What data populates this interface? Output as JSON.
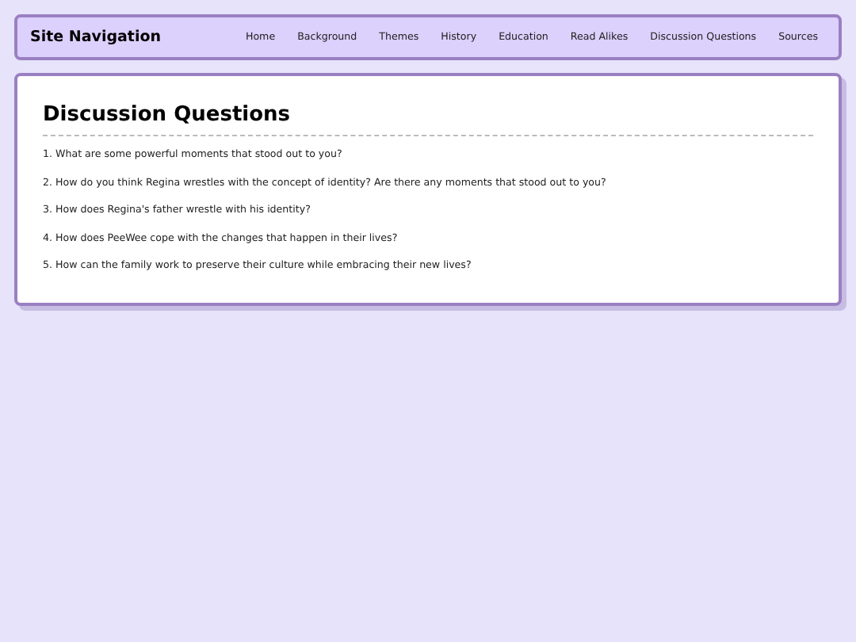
{
  "nav": {
    "title": "Site Navigation",
    "links": [
      "Home",
      "Background",
      "Themes",
      "History",
      "Education",
      "Read Alikes",
      "Discussion Questions",
      "Sources"
    ]
  },
  "main": {
    "heading": "Discussion Questions",
    "questions": [
      "1. What are some powerful moments that stood out to you?",
      "2. How do you think Regina wrestles with the concept of identity? Are there any moments that stood out to you?",
      "3. How does Regina's father wrestle with his identity?",
      "4. How does PeeWee cope with the changes that happen in their lives?",
      "5. How can the family work to preserve their culture while embracing their new lives?"
    ]
  }
}
